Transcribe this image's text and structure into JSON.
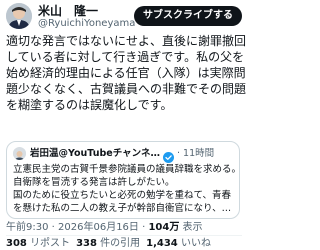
{
  "author": {
    "name": "米山　隆一",
    "handle": "@RyuichiYoneyama"
  },
  "subscribe_button": "サブスクライブする",
  "tweet_lines": [
    "適切な発言ではないにせよ、直後に謝罪撤回",
    "している者に対して行き過ぎです。私の父を",
    "始め経済的理由による任官（入隊）は実際問",
    "題少なくなく、古賀議員への非難でその問題",
    "を糊塗するのは誤魔化しです。"
  ],
  "quote": {
    "author": "岩田温@YouTubeチャンネル開設…",
    "time": "11時間",
    "lines": [
      "立憲民主党の古賀千景参院議員の議員辞職を求める。",
      "自衛隊を冒涜する発言は許しがたい。",
      "国のために役立ちたいと必死の勉学を重ねて、青春",
      "を懸けた私の二人の教え子が幹部自衛官になり、…"
    ]
  },
  "meta": {
    "time": "午前9:30",
    "date": "2026年06月16日",
    "views": "104万",
    "views_label": "表示"
  },
  "stats": {
    "retweets": "308",
    "retweets_label": "リポスト",
    "quotes": "338",
    "quotes_label": "件の引用",
    "likes": "1,434",
    "likes_label": "いいね"
  },
  "colors": {
    "text": "#0f1419",
    "muted": "#536471",
    "border": "#cfd9de",
    "button_bg": "#0f1419",
    "badge": "#1d9bf0"
  },
  "icons": {
    "verified": "verified-badge-icon"
  }
}
